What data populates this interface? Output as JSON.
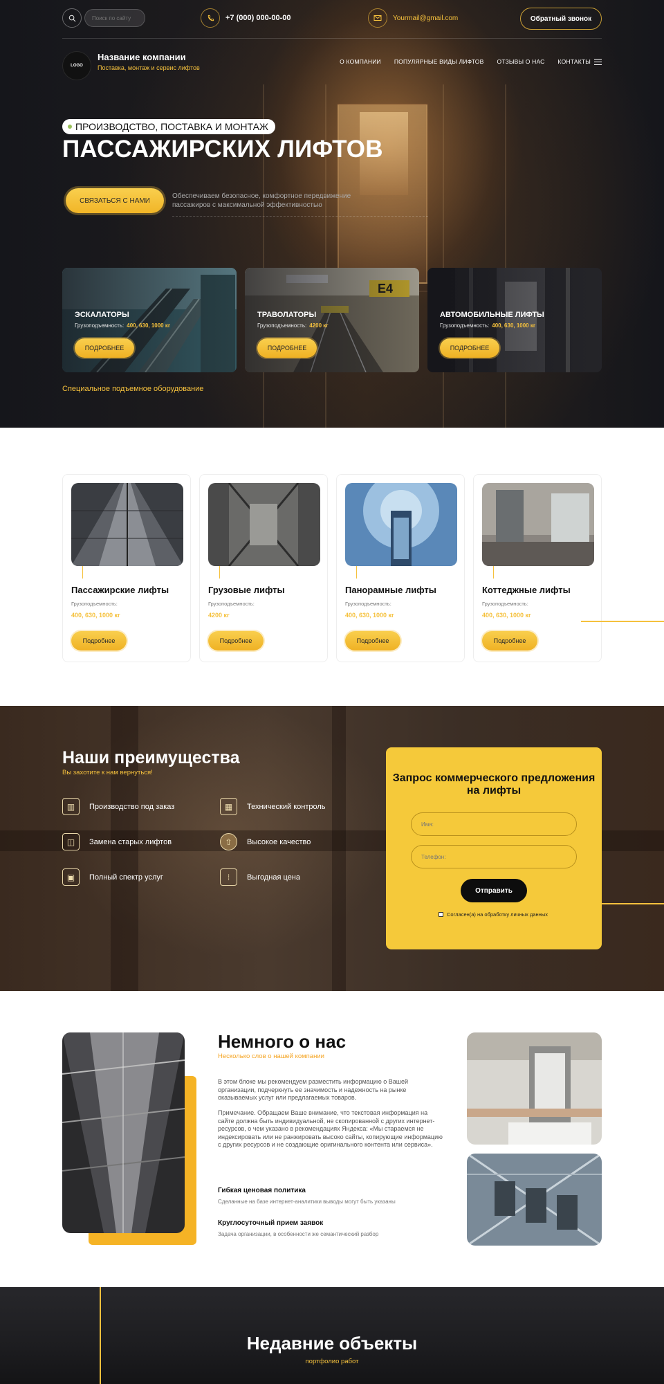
{
  "header": {
    "search_placeholder": "Поиск по сайту",
    "phone": "+7 (000) 000-00-00",
    "email": "Yourmail@gmail.com",
    "callback_label": "Обратный звонок",
    "logo_text": "LOGO",
    "company_name": "Название компании",
    "company_tagline": "Поставка, монтаж и сервис лифтов",
    "nav": [
      "О КОМПАНИИ",
      "ПОПУЛЯРНЫЕ ВИДЫ ЛИФТОВ",
      "ОТЗЫВЫ О НАС",
      "КОНТАКТЫ"
    ]
  },
  "hero": {
    "badge": "ПРОИЗВОДСТВО, ПОСТАВКА И МОНТАЖ",
    "title": "ПАССАЖИРСКИХ ЛИФТОВ",
    "cta_label": "СВЯЗАТЬСЯ С НАМИ",
    "cta_text": "Обеспечиваем безопасное, комфортное передвижение пассажиров с максимальной эффективностью",
    "categories": [
      {
        "title": "ЭСКАЛАТОРЫ",
        "capacity_label": "Грузоподъемность:",
        "capacity": "400, 630, 1000 кг",
        "button": "ПОДРОБНЕЕ"
      },
      {
        "title": "ТРАВОЛАТОРЫ",
        "capacity_label": "Грузоподъемность:",
        "capacity": "4200 кг",
        "button": "ПОДРОБНЕЕ",
        "sign": "E4"
      },
      {
        "title": "АВТОМОБИЛЬНЫЕ ЛИФТЫ",
        "capacity_label": "Грузоподъемность:",
        "capacity": "400, 630, 1000 кг",
        "button": "ПОДРОБНЕЕ"
      }
    ],
    "footnote": "Специальное подъемное оборудование"
  },
  "products": [
    {
      "title": "Пассажирские лифты",
      "capacity_label": "Грузоподъемность:",
      "capacity": "400, 630, 1000 кг",
      "button": "Подробнее"
    },
    {
      "title": "Грузовые лифты",
      "capacity_label": "Грузоподъемность:",
      "capacity": "4200 кг",
      "button": "Подробнее"
    },
    {
      "title": "Панорамные лифты",
      "capacity_label": "Грузоподъемность:",
      "capacity": "400, 630, 1000 кг",
      "button": "Подробнее"
    },
    {
      "title": "Коттеджные лифты",
      "capacity_label": "Грузоподъемность:",
      "capacity": "400, 630, 1000 кг",
      "button": "Подробнее"
    }
  ],
  "advantages": {
    "title": "Наши преимущества",
    "subtitle": "Вы захотите к нам вернуться!",
    "items": [
      {
        "label": "Производство под заказ",
        "icon": "factory-icon"
      },
      {
        "label": "Технический контроль",
        "icon": "control-panel-icon"
      },
      {
        "label": "Замена старых лифтов",
        "icon": "elevator-doors-icon"
      },
      {
        "label": "Высокое качество",
        "icon": "quality-elevator-icon"
      },
      {
        "label": "Полный спектр услуг",
        "icon": "elevator-cabin-icon"
      },
      {
        "label": "Выгодная цена",
        "icon": "elevator-buttons-icon"
      }
    ]
  },
  "quote_form": {
    "title": "Запрос коммерческого предложения на лифты",
    "name_placeholder": "Имя:",
    "phone_placeholder": "Телефон:",
    "submit": "Отправить",
    "consent": "Согласен(а) на обработку личных данных"
  },
  "about": {
    "title": "Немного о нас",
    "subtitle": "Несколько слов о нашей компании",
    "paragraph1": "В этом блоке мы рекомендуем разместить информацию о Вашей организации, подчеркнуть ее значимость и надежность на рынке оказываемых услуг или предлагаемых товаров.",
    "paragraph2": "Примечание. Обращаем Ваше внимание, что текстовая информация на сайте должна быть индивидуальной, не скопированной с других интернет-ресурсов, о чем указано в рекомендациях Яндекса: «Мы стараемся не индексировать или не ранжировать высоко сайты, копирующие информацию с других ресурсов и не создающие оригинального контента или сервиса».",
    "features": [
      {
        "title": "Гибкая ценовая политика",
        "text": "Сделанные на базе интернет-аналитики выводы могут быть указаны"
      },
      {
        "title": "Круглосуточный прием заявок",
        "text": "Задача организации, в особенности же семантический разбор"
      }
    ]
  },
  "recent": {
    "title": "Недавние объекты",
    "subtitle": "портфолио работ"
  },
  "colors": {
    "accent": "#f5c13d",
    "dark": "#15161b",
    "quote_bg": "#f5c93a",
    "about_accent_bg": "#f5b325"
  }
}
